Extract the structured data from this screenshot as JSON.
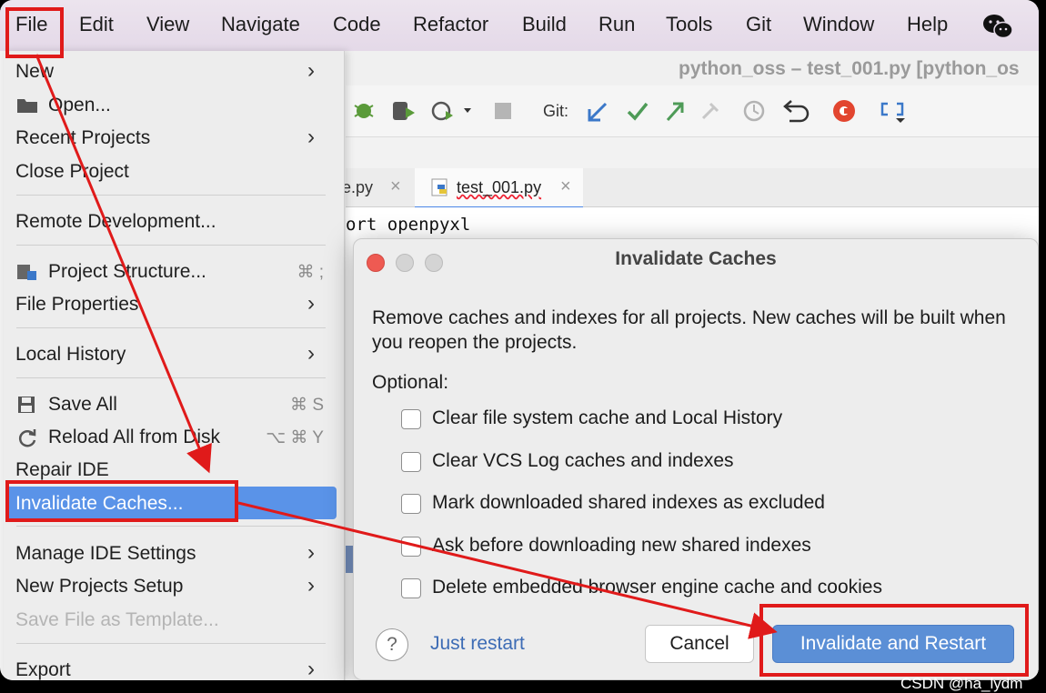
{
  "menubar": {
    "items": [
      "File",
      "Edit",
      "View",
      "Navigate",
      "Code",
      "Refactor",
      "Build",
      "Run",
      "Tools",
      "Git",
      "Window",
      "Help"
    ]
  },
  "ide": {
    "window_title": "python_oss – test_001.py [python_os",
    "git_label": "Git:",
    "tab1": "le.py",
    "tab2": "test_001.py",
    "code_lines": [
      "ort openpyxl"
    ]
  },
  "menu": {
    "new": "New",
    "open": "Open...",
    "recent": "Recent Projects",
    "close": "Close Project",
    "remote": "Remote Development...",
    "structure": "Project Structure...",
    "structure_sc": "⌘ ;",
    "properties": "File Properties",
    "history": "Local History",
    "save_all": "Save All",
    "save_all_sc": "⌘ S",
    "reload": "Reload All from Disk",
    "reload_sc": "⌥ ⌘ Y",
    "repair": "Repair IDE",
    "invalidate": "Invalidate Caches...",
    "manage": "Manage IDE Settings",
    "new_setup": "New Projects Setup",
    "save_template": "Save File as Template...",
    "export": "Export"
  },
  "dialog": {
    "title": "Invalidate Caches",
    "description": "Remove caches and indexes for all projects. New caches will be built when you reopen the projects.",
    "optional": "Optional:",
    "options": [
      "Clear file system cache and Local History",
      "Clear VCS Log caches and indexes",
      "Mark downloaded shared indexes as excluded",
      "Ask before downloading new shared indexes",
      "Delete embedded browser engine cache and cookies"
    ],
    "help": "?",
    "just_restart": "Just restart",
    "cancel": "Cancel",
    "invalidate_restart": "Invalidate and Restart"
  },
  "watermark": "CSDN @ha_lydm",
  "colors": {
    "annotation": "#e01a1a",
    "selection": "#5a93e8",
    "primary_button": "#5b8fd6"
  }
}
